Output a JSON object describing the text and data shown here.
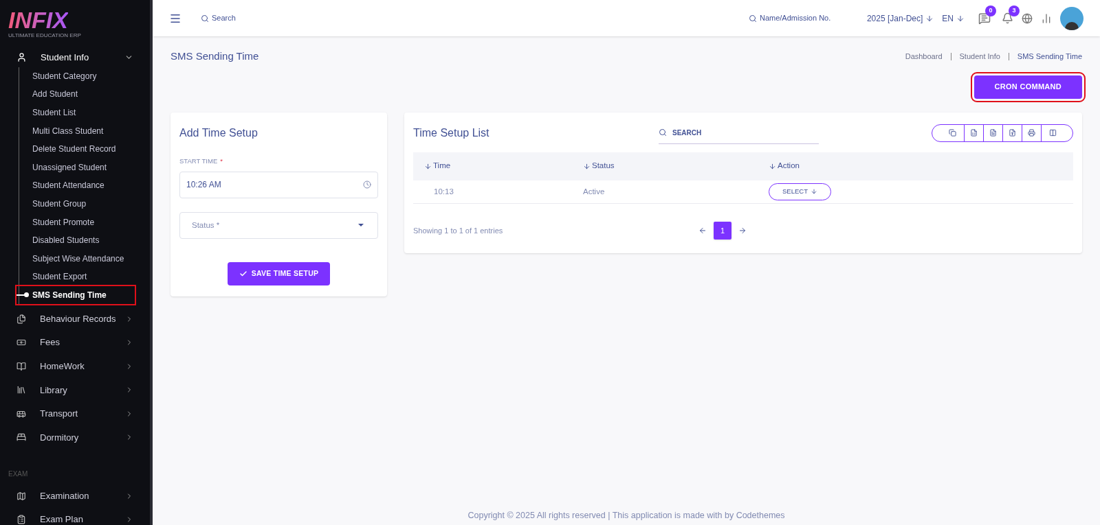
{
  "logo": {
    "name": "INFIX",
    "tagline": "ULTIMATE EDUCATION ERP"
  },
  "sidebar": {
    "open_menu": {
      "label": "Student Info",
      "expanded": true,
      "children": [
        {
          "label": "Student Category",
          "selected": false,
          "highlighted": false
        },
        {
          "label": "Add Student",
          "selected": false,
          "highlighted": false
        },
        {
          "label": "Student List",
          "selected": false,
          "highlighted": false
        },
        {
          "label": "Multi Class Student",
          "selected": false,
          "highlighted": false
        },
        {
          "label": "Delete Student Record",
          "selected": false,
          "highlighted": false
        },
        {
          "label": "Unassigned Student",
          "selected": false,
          "highlighted": false
        },
        {
          "label": "Student Attendance",
          "selected": false,
          "highlighted": false
        },
        {
          "label": "Student Group",
          "selected": false,
          "highlighted": false
        },
        {
          "label": "Student Promote",
          "selected": false,
          "highlighted": false
        },
        {
          "label": "Disabled Students",
          "selected": false,
          "highlighted": false
        },
        {
          "label": "Subject Wise Attendance",
          "selected": false,
          "highlighted": false
        },
        {
          "label": "Student Export",
          "selected": false,
          "highlighted": false
        },
        {
          "label": "SMS Sending Time",
          "selected": true,
          "highlighted": true
        }
      ]
    },
    "menus": [
      {
        "label": "Behaviour Records"
      },
      {
        "label": "Fees"
      },
      {
        "label": "HomeWork"
      },
      {
        "label": "Library"
      },
      {
        "label": "Transport"
      },
      {
        "label": "Dormitory"
      }
    ],
    "section": "EXAM",
    "exam_menus": [
      {
        "label": "Examination"
      },
      {
        "label": "Exam Plan"
      }
    ]
  },
  "header": {
    "search_placeholder": "Search",
    "student_search_placeholder": "Name/Admission No.",
    "session": "2025 [Jan-Dec]",
    "language": "EN",
    "message_count": "0",
    "notification_count": "3"
  },
  "page": {
    "title": "SMS Sending Time",
    "breadcrumbs": [
      "Dashboard",
      "Student Info",
      "SMS Sending Time"
    ],
    "cron_button": {
      "label": "CRON COMMAND",
      "highlighted": true
    }
  },
  "form": {
    "title": "Add Time Setup",
    "start_time_label": "START TIME",
    "required_mark": "*",
    "start_time_value": "10:26 AM",
    "status_placeholder": "Status *",
    "save_button": "SAVE TIME SETUP"
  },
  "list": {
    "title": "Time Setup List",
    "search_placeholder": "SEARCH",
    "columns": [
      "Time",
      "Status",
      "Action"
    ],
    "rows": [
      {
        "time": "10:13",
        "status": "Active",
        "action": "SELECT"
      }
    ],
    "info": "Showing 1 to 1 of 1 entries",
    "pages": [
      {
        "label": "1",
        "selected": true
      }
    ]
  },
  "footer": "Copyright © 2025 All rights reserved | This application is made with by Codethemes"
}
